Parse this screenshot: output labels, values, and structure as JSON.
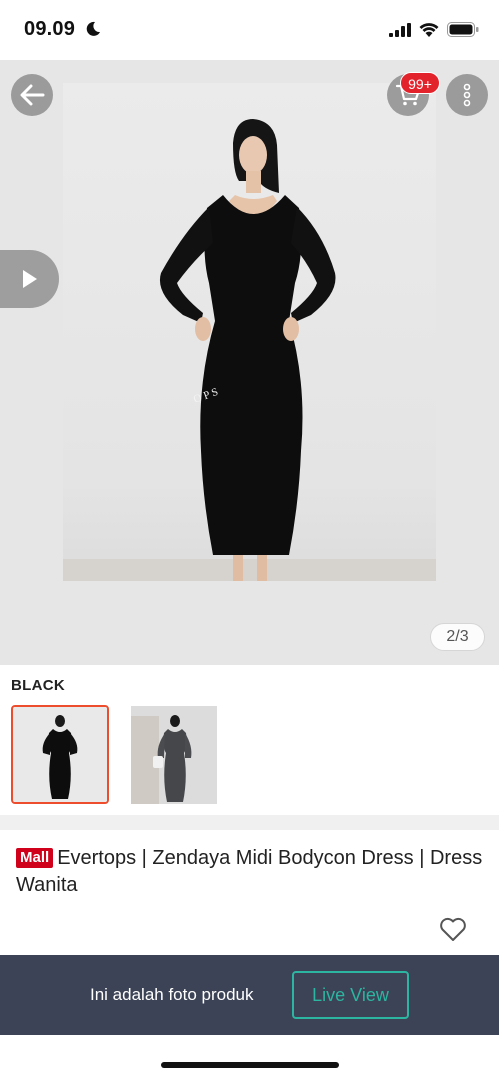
{
  "status_bar": {
    "time": "09.09",
    "icons": [
      "moon-icon",
      "signal-icon",
      "wifi-icon",
      "battery-icon"
    ]
  },
  "gallery": {
    "cart_badge": "99+",
    "page_indicator": "2/3",
    "watermark": "OPS",
    "icons": [
      "back-arrow-icon",
      "cart-icon",
      "more-vertical-icon",
      "play-icon"
    ]
  },
  "variation": {
    "label": "BLACK",
    "options": [
      "Black",
      "Dark Grey"
    ],
    "selected_index": 0
  },
  "product": {
    "mall_badge": "Mall",
    "title": "Evertops | Zendaya Midi Bodycon Dress | Dress Wanita",
    "icons": [
      "heart-icon"
    ]
  },
  "live_bar": {
    "text": "Ini adalah foto produk",
    "button": "Live View"
  },
  "colors": {
    "accent_red": "#ee4d2d",
    "badge_red": "#e3232c",
    "mall_red": "#d0011b",
    "live_bar_bg": "#3c4356",
    "live_button": "#2cb5a0"
  }
}
